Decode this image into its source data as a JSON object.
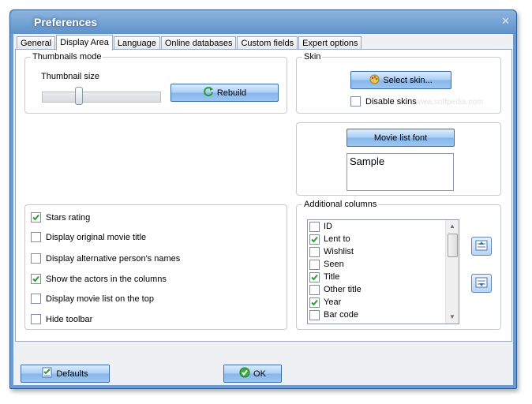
{
  "window": {
    "title": "Preferences",
    "close_glyph": "✕"
  },
  "tabs": [
    {
      "label": "General"
    },
    {
      "label": "Display Area",
      "active": true
    },
    {
      "label": "Language"
    },
    {
      "label": "Online databases"
    },
    {
      "label": "Custom fields"
    },
    {
      "label": "Expert options"
    }
  ],
  "thumbnails": {
    "group_label": "Thumbnails mode",
    "size_label": "Thumbnail size",
    "slider_value": 0.3,
    "rebuild_label": "Rebuild",
    "rebuild_icon": "refresh-icon"
  },
  "skin": {
    "group_label": "Skin",
    "select_label": "Select skin...",
    "select_icon": "palette-icon",
    "disable_label": "Disable skins",
    "disable_checked": false,
    "watermark": "SOFTPEDIA",
    "watermark_url": "www.softpedia.com"
  },
  "font": {
    "button_label": "Movie list font",
    "sample_text": "Sample"
  },
  "options": [
    {
      "label": "Stars rating",
      "checked": true
    },
    {
      "label": "Display original movie title",
      "checked": false
    },
    {
      "label": "Display alternative person's names",
      "checked": false
    },
    {
      "label": "Show the actors in the columns",
      "checked": true
    },
    {
      "label": "Display movie list on the top",
      "checked": false
    },
    {
      "label": "Hide toolbar",
      "checked": false
    }
  ],
  "columns": {
    "group_label": "Additional columns",
    "items": [
      {
        "label": "ID",
        "checked": false
      },
      {
        "label": "Lent to",
        "checked": true
      },
      {
        "label": "Wishlist",
        "checked": false
      },
      {
        "label": "Seen",
        "checked": false
      },
      {
        "label": "Title",
        "checked": true
      },
      {
        "label": "Other title",
        "checked": false
      },
      {
        "label": "Year",
        "checked": true
      },
      {
        "label": "Bar code",
        "checked": false
      }
    ]
  },
  "footer": {
    "defaults_label": "Defaults",
    "defaults_icon": "checklist-icon",
    "ok_label": "OK",
    "ok_icon": "check-circle-icon"
  },
  "colors": {
    "check_green": "#2e9b2e",
    "accent": "#3c6ea6"
  }
}
